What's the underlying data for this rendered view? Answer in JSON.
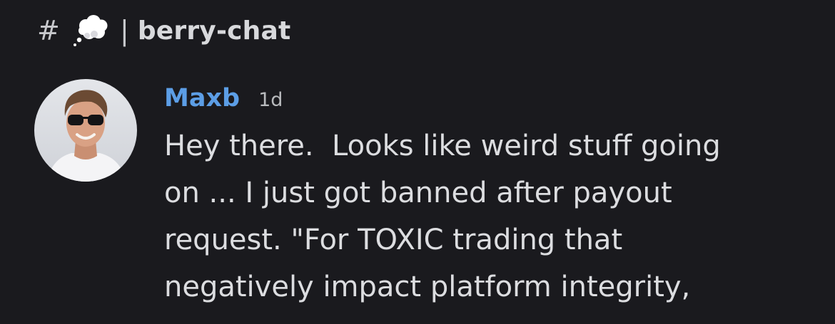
{
  "channel": {
    "hash_symbol": "#",
    "emoji_icon": "thought-balloon-icon",
    "divider": "|",
    "name": "berry-chat"
  },
  "message": {
    "author": "Maxb",
    "timestamp": "1d",
    "author_color": "#5c9ee6",
    "lines": [
      "Hey there.  Looks like weird stuff going",
      "on ... I just got banned after payout",
      "request. \"For TOXIC trading that",
      "negatively impact platform integrity,"
    ]
  },
  "colors": {
    "background": "#1a1a1e",
    "text": "#dcdde0",
    "muted": "#b9bbbe"
  }
}
